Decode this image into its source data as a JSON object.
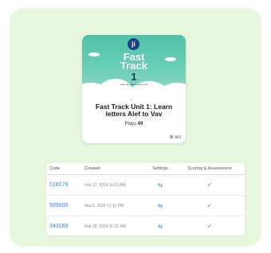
{
  "card": {
    "badge": "ji",
    "image_title_line1": "Fast",
    "image_title_line2": "Track",
    "image_unit_number": "1",
    "image_subtitle": "learn the letters alef to vav",
    "title": "Fast Track Unit 1: Learn letters Alef to Vav",
    "plays_label": "Plays",
    "plays_count": "69",
    "language": "en"
  },
  "table": {
    "headers": {
      "code": "Code",
      "created": "Created",
      "settings": "Settings",
      "scoring": "Scoring & Assessment"
    },
    "rows": [
      {
        "code": "018176",
        "created": "Feb 27, 2024 11:03 AM"
      },
      {
        "code": "505000",
        "created": "Mar 5, 2024 12:11 PM"
      },
      {
        "code": "343169",
        "created": "Feb 28, 2024 11:21 AM"
      }
    ]
  },
  "icons": {
    "settings": "arrows-icon",
    "scoring": "check-icon",
    "globe": "globe-icon"
  },
  "colors": {
    "panel_background": "#e6f7de",
    "accent_blue": "#3a7be0",
    "card_teal": "#4fc1a8"
  }
}
